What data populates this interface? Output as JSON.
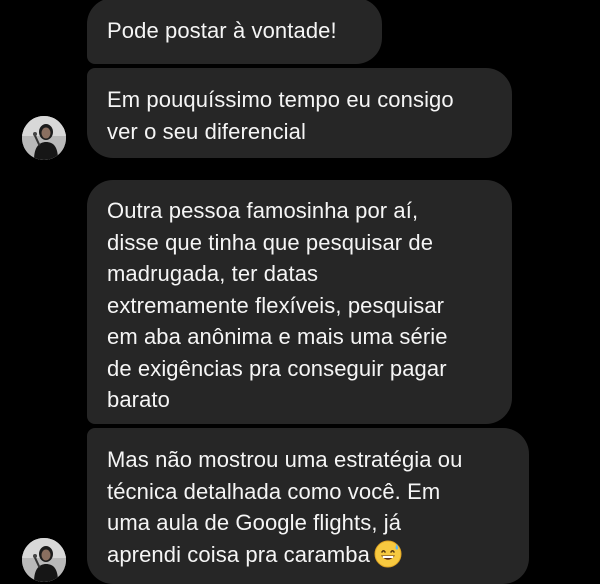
{
  "messages": [
    {
      "text": "Pode postar à vontade!"
    },
    {
      "text": "Em pouquíssimo tempo eu consigo\nver o seu diferencial"
    },
    {
      "text": "Outra pessoa famosinha por aí,\ndisse que tinha que pesquisar de\nmadrugada, ter datas\nextremamente flexíveis, pesquisar\nem aba anônima e mais uma série\nde exigências pra conseguir pagar\nbarato"
    },
    {
      "text": "Mas não mostrou uma estratégia ou\ntécnica detalhada como você. Em\numa aula de Google flights, já\naprendi coisa pra caramba",
      "emoji": "grinning-sweat-emoji"
    }
  ],
  "colors": {
    "background": "#000000",
    "bubble": "#262626",
    "text": "#f5f5f5"
  }
}
